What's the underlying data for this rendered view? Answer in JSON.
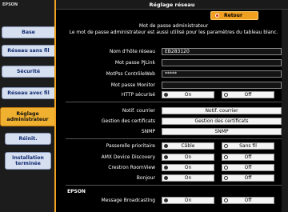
{
  "window": {
    "title": "Réglage réseau"
  },
  "brand": {
    "logo": "EPSON"
  },
  "sidebar": {
    "items": [
      {
        "label": "Base"
      },
      {
        "label": "Réseau sans fil"
      },
      {
        "label": "Sécurité"
      },
      {
        "label": "Réseau avec fil"
      },
      {
        "label": "Réglage administrateur"
      },
      {
        "label": "Réinit."
      },
      {
        "label": "Installation terminée"
      }
    ]
  },
  "header": {
    "back_label": "Retour"
  },
  "admin": {
    "password_label": "Mot de passe administrateur",
    "note": "Le mot de passe administrateur est aussi utilisé pour les paramètres du tableau blanc."
  },
  "fields": {
    "hostname": {
      "label": "Nom d'hôte réseau",
      "value": "EB283120"
    },
    "pjlink": {
      "label": "Mot passe PJLink",
      "value": ""
    },
    "webcontrol": {
      "label": "MotPss ContrôleWeb",
      "value": "*****"
    },
    "monitor": {
      "label": "Mot passe Monitor",
      "value": ""
    }
  },
  "https": {
    "label": "HTTP sécurisé",
    "on": "On",
    "off": "Off",
    "selected": "On"
  },
  "mail": {
    "label": "Notif. courrier",
    "button": "Notif. courrier"
  },
  "certs": {
    "label": "Gestion des certificats",
    "button": "Gestion des certificats"
  },
  "snmp": {
    "label": "SNMP",
    "button": "SNMP"
  },
  "gateway": {
    "label": "Passerelle prioritaire",
    "on": "Câble",
    "off": "Sans fil",
    "selected": "Câble"
  },
  "amx": {
    "label": "AMX Device Discovery",
    "on": "On",
    "off": "Off",
    "selected": "On"
  },
  "crestron": {
    "label": "Crestron RoomView",
    "on": "On",
    "off": "Off",
    "selected": "On"
  },
  "bonjour": {
    "label": "Bonjour",
    "on": "On",
    "off": "Off",
    "selected": "On"
  },
  "epson_section": {
    "title": "EPSON"
  },
  "broadcast": {
    "label": "Message Broadcasting",
    "on": "On",
    "off": "Off",
    "selected": "On"
  }
}
